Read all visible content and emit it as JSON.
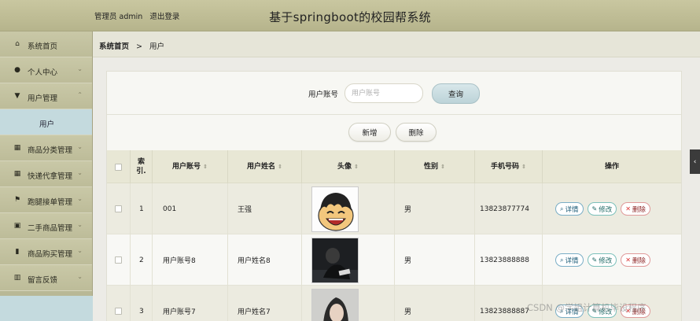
{
  "header": {
    "admin_label": "管理员 admin",
    "logout_label": "退出登录",
    "title": "基于springboot的校园帮系统"
  },
  "sidebar": {
    "items": [
      {
        "label": "系统首页",
        "icon": "home-icon",
        "glyph": "⌂",
        "chevron": ""
      },
      {
        "label": "个人中心",
        "icon": "user-icon",
        "glyph": "●",
        "chevron": "⌄"
      },
      {
        "label": "用户管理",
        "icon": "pin-icon",
        "glyph": "▼",
        "chevron": "⌃"
      },
      {
        "label": "用户",
        "sub": true
      },
      {
        "label": "商品分类管理",
        "icon": "grid-icon",
        "glyph": "▦",
        "chevron": "⌄"
      },
      {
        "label": "快递代拿管理",
        "icon": "grid-icon",
        "glyph": "▦",
        "chevron": "⌄"
      },
      {
        "label": "跑腿接单管理",
        "icon": "flag-icon",
        "glyph": "⚑",
        "chevron": "⌄"
      },
      {
        "label": "二手商品管理",
        "icon": "clipboard-icon",
        "glyph": "▣",
        "chevron": "⌄"
      },
      {
        "label": "商品购买管理",
        "icon": "bar-chart-icon",
        "glyph": "▮",
        "chevron": "⌄"
      },
      {
        "label": "留言反馈",
        "icon": "book-icon",
        "glyph": "▥",
        "chevron": "⌄"
      }
    ]
  },
  "breadcrumb": {
    "home": "系统首页",
    "separator": ">",
    "current": "用户"
  },
  "search": {
    "label": "用户账号",
    "placeholder": "用户账号",
    "value": "",
    "query_button": "查询"
  },
  "actions": {
    "add_label": "新增",
    "delete_label": "删除"
  },
  "table": {
    "columns": [
      "索引",
      "用户账号",
      "用户姓名",
      "头像",
      "性别",
      "手机号码",
      "操作"
    ],
    "index_header_line1": "索",
    "index_header_line2": "引.",
    "sort_glyph": "⇕",
    "op_labels": {
      "detail": "详情",
      "edit": "修改",
      "delete": "删除"
    },
    "op_glyphs": {
      "detail": "⌕",
      "edit": "✎",
      "delete": "✕"
    },
    "rows": [
      {
        "index": "1",
        "account": "001",
        "name": "王强",
        "gender": "男",
        "phone": "13823877774",
        "avatar": "cartoon-avatar"
      },
      {
        "index": "2",
        "account": "用户账号8",
        "name": "用户姓名8",
        "gender": "男",
        "phone": "13823888888",
        "avatar": "dark-photo-avatar"
      },
      {
        "index": "3",
        "account": "用户账号7",
        "name": "用户姓名7",
        "gender": "男",
        "phone": "13823888887",
        "avatar": "portrait-avatar"
      }
    ]
  },
  "side_handle_glyph": "‹",
  "watermark": "CSDN @学姐计算机毕设程序",
  "colors": {
    "header_bg": "#bfbd95",
    "sidebar_bg": "#c3c2a0",
    "active_submenu_bg": "#c4dade",
    "query_button_bg": "#c8dde1",
    "table_header_bg": "#e8e7d5",
    "delete_accent": "#d33333"
  }
}
